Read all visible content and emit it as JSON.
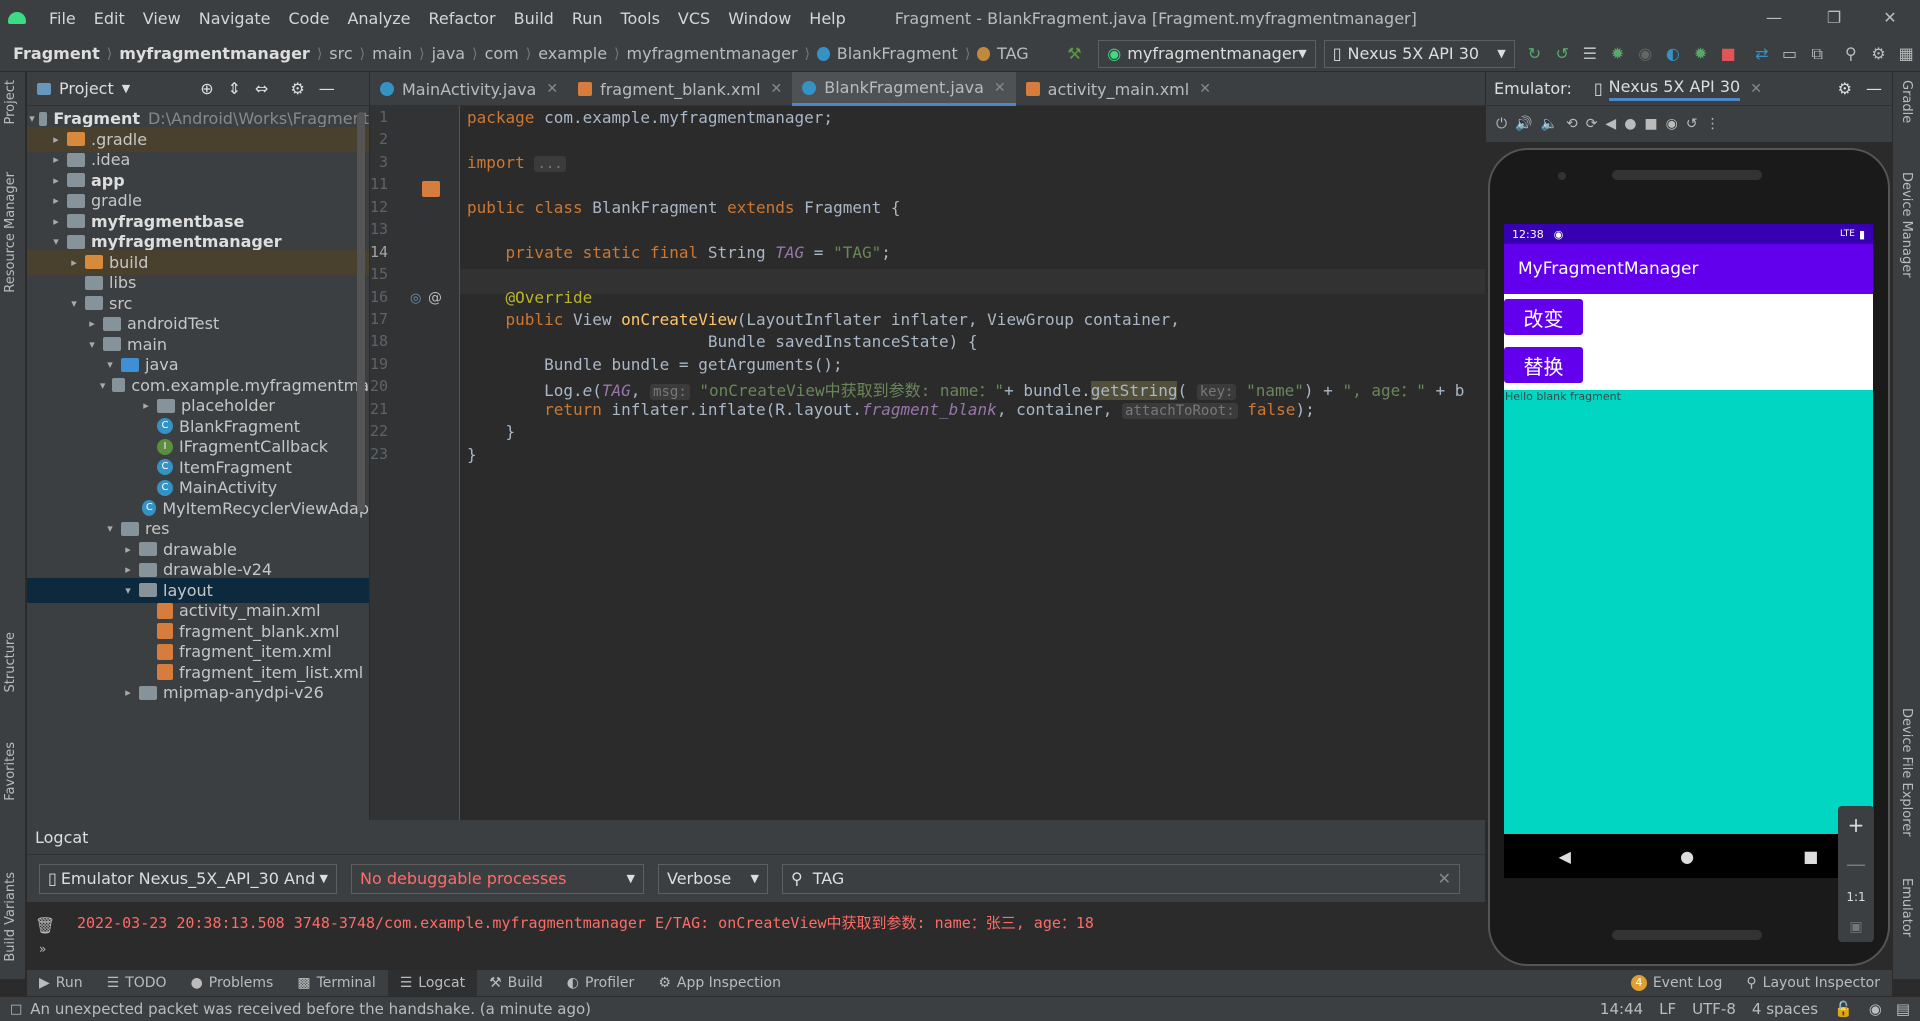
{
  "menu": {
    "items": [
      "File",
      "Edit",
      "View",
      "Navigate",
      "Code",
      "Analyze",
      "Refactor",
      "Build",
      "Run",
      "Tools",
      "VCS",
      "Window",
      "Help"
    ],
    "title": "Fragment - BlankFragment.java [Fragment.myfragmentmanager]"
  },
  "nav": {
    "crumbs": [
      "Fragment",
      "myfragmentmanager",
      "src",
      "main",
      "java",
      "com",
      "example",
      "myfragmentmanager",
      "BlankFragment",
      "TAG"
    ],
    "run_config": "myfragmentmanager",
    "device": "Nexus 5X API 30"
  },
  "project": {
    "title": "Project",
    "rows": [
      {
        "label": "Fragment",
        "extra": "D:\\Android\\Works\\Fragment",
        "depth": 0,
        "arrow": "open",
        "icon": "module",
        "bold": true
      },
      {
        "label": ".gradle",
        "depth": 1,
        "arrow": "closed",
        "icon": "folder-orange",
        "hl": true
      },
      {
        "label": ".idea",
        "depth": 1,
        "arrow": "closed",
        "icon": "folder"
      },
      {
        "label": "app",
        "depth": 1,
        "arrow": "closed",
        "icon": "module",
        "bold": true
      },
      {
        "label": "gradle",
        "depth": 1,
        "arrow": "closed",
        "icon": "folder"
      },
      {
        "label": "myfragmentbase",
        "depth": 1,
        "arrow": "closed",
        "icon": "module",
        "bold": true
      },
      {
        "label": "myfragmentmanager",
        "depth": 1,
        "arrow": "open",
        "icon": "module",
        "bold": true
      },
      {
        "label": "build",
        "depth": 2,
        "arrow": "closed",
        "icon": "folder-orange",
        "hl": true
      },
      {
        "label": "libs",
        "depth": 2,
        "arrow": "",
        "icon": "folder"
      },
      {
        "label": "src",
        "depth": 2,
        "arrow": "open",
        "icon": "folder"
      },
      {
        "label": "androidTest",
        "depth": 3,
        "arrow": "closed",
        "icon": "folder"
      },
      {
        "label": "main",
        "depth": 3,
        "arrow": "open",
        "icon": "folder"
      },
      {
        "label": "java",
        "depth": 4,
        "arrow": "open",
        "icon": "folder-blue"
      },
      {
        "label": "com.example.myfragmentma",
        "depth": 5,
        "arrow": "open",
        "icon": "package"
      },
      {
        "label": "placeholder",
        "depth": 6,
        "arrow": "closed",
        "icon": "package"
      },
      {
        "label": "BlankFragment",
        "depth": 6,
        "arrow": "",
        "icon": "class"
      },
      {
        "label": "IFragmentCallback",
        "depth": 6,
        "arrow": "",
        "icon": "interface"
      },
      {
        "label": "ItemFragment",
        "depth": 6,
        "arrow": "",
        "icon": "class"
      },
      {
        "label": "MainActivity",
        "depth": 6,
        "arrow": "",
        "icon": "class"
      },
      {
        "label": "MyItemRecyclerViewAdap",
        "depth": 6,
        "arrow": "",
        "icon": "class"
      },
      {
        "label": "res",
        "depth": 4,
        "arrow": "open",
        "icon": "folder"
      },
      {
        "label": "drawable",
        "depth": 5,
        "arrow": "closed",
        "icon": "folder"
      },
      {
        "label": "drawable-v24",
        "depth": 5,
        "arrow": "closed",
        "icon": "folder"
      },
      {
        "label": "layout",
        "depth": 5,
        "arrow": "open",
        "icon": "folder",
        "sel": true
      },
      {
        "label": "activity_main.xml",
        "depth": 6,
        "arrow": "",
        "icon": "xml"
      },
      {
        "label": "fragment_blank.xml",
        "depth": 6,
        "arrow": "",
        "icon": "xml"
      },
      {
        "label": "fragment_item.xml",
        "depth": 6,
        "arrow": "",
        "icon": "xml"
      },
      {
        "label": "fragment_item_list.xml",
        "depth": 6,
        "arrow": "",
        "icon": "xml"
      },
      {
        "label": "mipmap-anydpi-v26",
        "depth": 5,
        "arrow": "closed",
        "icon": "folder"
      }
    ]
  },
  "tabs": [
    {
      "label": "MainActivity.java",
      "icon": "class",
      "active": false
    },
    {
      "label": "fragment_blank.xml",
      "icon": "xml",
      "active": false
    },
    {
      "label": "BlankFragment.java",
      "icon": "class",
      "active": true
    },
    {
      "label": "activity_main.xml",
      "icon": "xml",
      "active": false
    }
  ],
  "editor": {
    "line_numbers": [
      "1",
      "2",
      "3",
      "11",
      "12",
      "13",
      "14",
      "15",
      "16",
      "17",
      "18",
      "19",
      "20",
      "21",
      "22",
      "23"
    ],
    "current_line": "14"
  },
  "emulator": {
    "label": "Emulator:",
    "device_tab": "Nexus 5X API 30",
    "status_time": "12:38",
    "status_right": "LTE",
    "app_title": "MyFragmentManager",
    "btn_change": "改变",
    "btn_replace": "替换",
    "fragment_text": "Hello blank fragment",
    "zoom_label": "1:1"
  },
  "logcat": {
    "title": "Logcat",
    "device": "Emulator Nexus_5X_API_30 Andr",
    "process": "No debuggable processes",
    "level": "Verbose",
    "search": "TAG",
    "line": "2022-03-23 20:38:13.508 3748-3748/com.example.myfragmentmanager E/TAG: onCreateView中获取到参数: name：张三, age：18"
  },
  "toolwindows": {
    "left": [
      "Run",
      "TODO",
      "Problems",
      "Terminal",
      "Logcat",
      "Build",
      "Profiler",
      "App Inspection"
    ],
    "right": [
      "Event Log",
      "Layout Inspector"
    ],
    "event_count": "4"
  },
  "sidebars": {
    "left": [
      "Project",
      "Resource Manager",
      "Structure",
      "Favorites",
      "Build Variants"
    ],
    "right": [
      "Gradle",
      "Device Manager",
      "Device File Explorer",
      "Emulator"
    ]
  },
  "status": {
    "message": "An unexpected packet was received before the handshake. (a minute ago)",
    "position": "14:44",
    "line_sep": "LF",
    "encoding": "UTF-8",
    "indent": "4 spaces"
  }
}
